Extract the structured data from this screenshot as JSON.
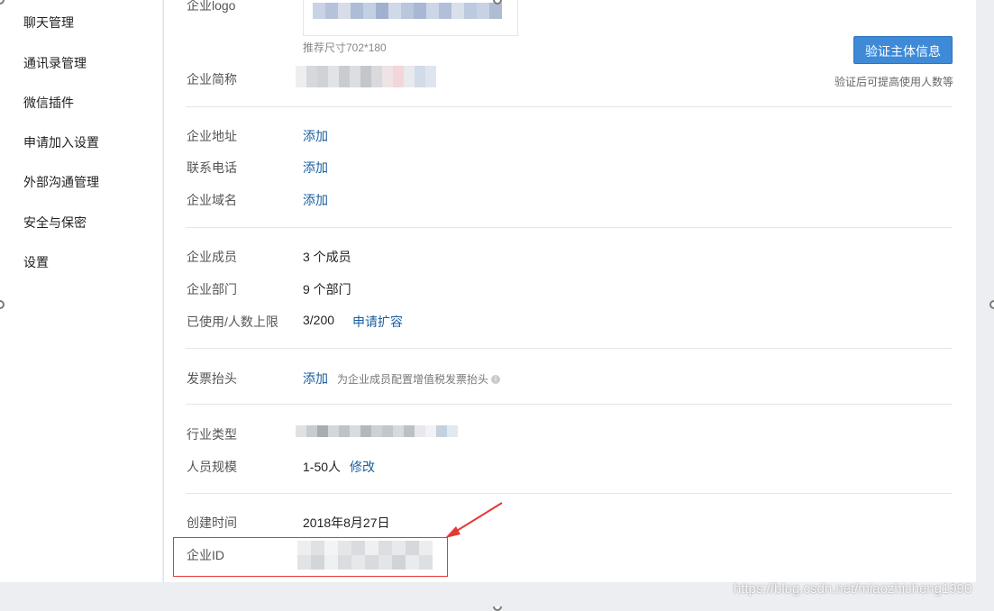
{
  "sidebar": {
    "items": [
      {
        "label": "聊天管理"
      },
      {
        "label": "通讯录管理"
      },
      {
        "label": "微信插件"
      },
      {
        "label": "申请加入设置"
      },
      {
        "label": "外部沟通管理"
      },
      {
        "label": "安全与保密"
      },
      {
        "label": "设置"
      }
    ]
  },
  "profile": {
    "logo_label": "企业logo",
    "logo_hint": "推荐尺寸702*180",
    "short_name_label": "企业简称",
    "verify_button": "验证主体信息",
    "verify_tip": "验证后可提高使用人数等",
    "address_label": "企业地址",
    "address_action": "添加",
    "phone_label": "联系电话",
    "phone_action": "添加",
    "domain_label": "企业域名",
    "domain_action": "添加",
    "members_label": "企业成员",
    "members_value": "3 个成员",
    "departments_label": "企业部门",
    "departments_value": "9 个部门",
    "limit_label": "已使用/人数上限",
    "limit_value": "3/200",
    "limit_action": "申请扩容",
    "invoice_label": "发票抬头",
    "invoice_action": "添加",
    "invoice_hint": "为企业成员配置增值税发票抬头",
    "industry_label": "行业类型",
    "scale_label": "人员规模",
    "scale_value": "1-50人",
    "scale_action": "修改",
    "created_label": "创建时间",
    "created_value": "2018年8月27日",
    "corp_id_label": "企业ID"
  },
  "watermark": "https://blog.csdn.net/miaozhicheng1990",
  "colors": {
    "link": "#1a5fa0",
    "primary_button": "#3e8ad7",
    "highlight": "#e53935"
  },
  "icons": {
    "info": "info-icon",
    "arrow": "red-arrow-icon"
  }
}
